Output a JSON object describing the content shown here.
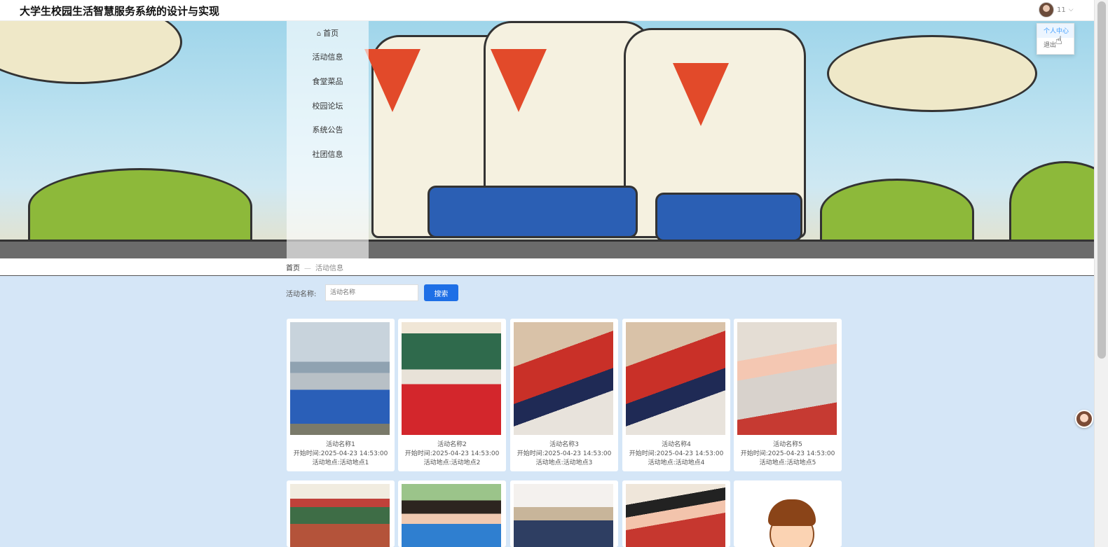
{
  "header": {
    "title": "大学生校园生活智慧服务系统的设计与实现",
    "user_name": "11",
    "chevron_icon": "chevron-down-icon",
    "dropdown": [
      "个人中心",
      "退出"
    ]
  },
  "nav": {
    "items": [
      "首页",
      "活动信息",
      "食堂菜品",
      "校园论坛",
      "系统公告",
      "社团信息"
    ],
    "home_icon": "home-icon"
  },
  "breadcrumb": {
    "home": "首页",
    "separator": "—",
    "current": "活动信息"
  },
  "search": {
    "label": "活动名称:",
    "placeholder": "活动名称",
    "button": "搜索"
  },
  "cards": [
    {
      "name": "活动名称1",
      "time": "开始时间:2025-04-23 14:53:00",
      "location": "活动地点:活动地点1"
    },
    {
      "name": "活动名称2",
      "time": "开始时间:2025-04-23 14:53:00",
      "location": "活动地点:活动地点2"
    },
    {
      "name": "活动名称3",
      "time": "开始时间:2025-04-23 14:53:00",
      "location": "活动地点:活动地点3"
    },
    {
      "name": "活动名称4",
      "time": "开始时间:2025-04-23 14:53:00",
      "location": "活动地点:活动地点4"
    },
    {
      "name": "活动名称5",
      "time": "开始时间:2025-04-23 14:53:00",
      "location": "活动地点:活动地点5"
    }
  ],
  "colors": {
    "accent": "#1e6fe6",
    "page_background": "#d5e6f7"
  }
}
